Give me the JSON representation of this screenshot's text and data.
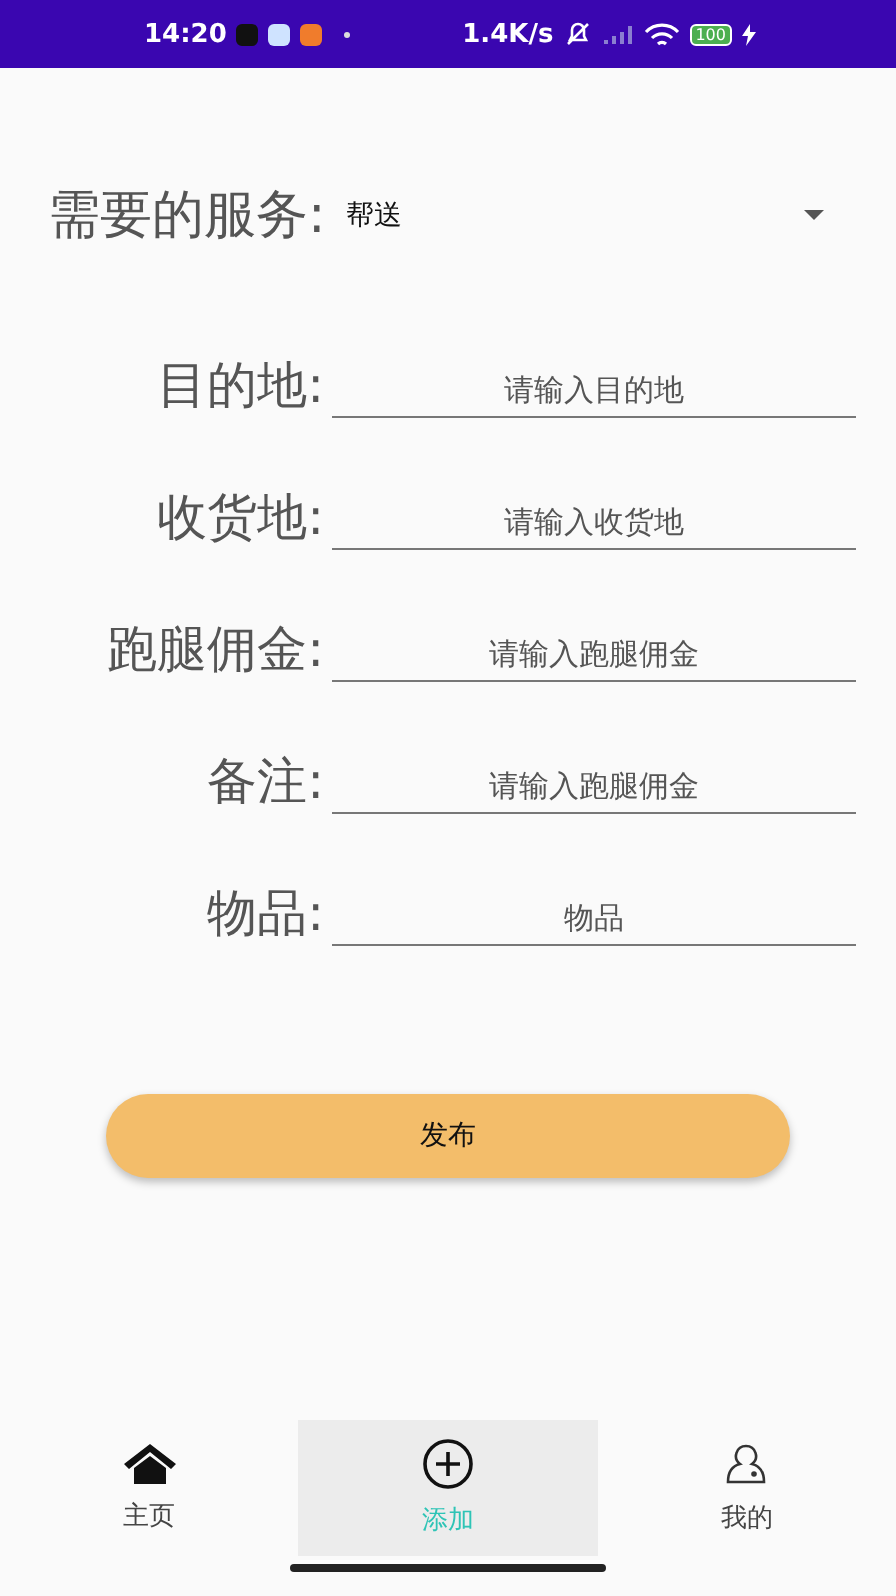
{
  "status_bar": {
    "time": "14:20",
    "net_speed": "1.4K/s",
    "battery": "100"
  },
  "service": {
    "label": "需要的服务:",
    "value": "帮送"
  },
  "fields": [
    {
      "label": "目的地:",
      "placeholder": "请输入目的地"
    },
    {
      "label": "收货地:",
      "placeholder": "请输入收货地"
    },
    {
      "label": "跑腿佣金:",
      "placeholder": "请输入跑腿佣金"
    },
    {
      "label": "备注:",
      "placeholder": "请输入跑腿佣金"
    },
    {
      "label": "物品:",
      "placeholder": "物品"
    }
  ],
  "submit": "发布",
  "tabs": [
    {
      "label": "主页",
      "kind": "home",
      "selected": false
    },
    {
      "label": "添加",
      "kind": "add",
      "selected": true
    },
    {
      "label": "我的",
      "kind": "profile",
      "selected": false
    }
  ]
}
